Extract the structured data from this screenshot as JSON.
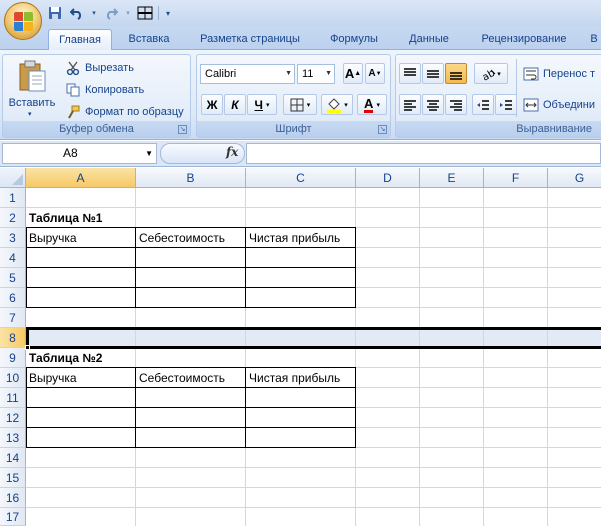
{
  "quick_access": {
    "save_icon": "save-icon",
    "undo_icon": "undo-icon",
    "redo_icon": "redo-icon",
    "customize_icon": "customize-qat-icon"
  },
  "tabs": [
    {
      "label": "Главная",
      "active": true
    },
    {
      "label": "Вставка"
    },
    {
      "label": "Разметка страницы"
    },
    {
      "label": "Формулы"
    },
    {
      "label": "Данные"
    },
    {
      "label": "Рецензирование"
    },
    {
      "label": "В"
    }
  ],
  "ribbon": {
    "clipboard": {
      "label": "Буфер обмена",
      "paste": "Вставить",
      "cut": "Вырезать",
      "copy": "Копировать",
      "format_painter": "Формат по образцу"
    },
    "font": {
      "label": "Шрифт",
      "font_name": "Calibri",
      "font_size": "11",
      "bold": "Ж",
      "italic": "К",
      "underline": "Ч",
      "grow": "A",
      "shrink": "A",
      "font_color_letter": "A"
    },
    "alignment": {
      "label": "Выравнивание",
      "wrap_text": "Перенос т",
      "merge": "Объедини"
    }
  },
  "formula_bar": {
    "name_box": "A8",
    "fx": "fx",
    "value": ""
  },
  "sheet": {
    "columns": [
      "A",
      "B",
      "C",
      "D",
      "E",
      "F",
      "G"
    ],
    "rows": [
      "1",
      "2",
      "3",
      "4",
      "5",
      "6",
      "7",
      "8",
      "9",
      "10",
      "11",
      "12",
      "13",
      "14",
      "15",
      "16",
      "17"
    ],
    "selected_row": "8",
    "selected_cell": "A8",
    "table1": {
      "title": "Таблица №1",
      "headers": [
        "Выручка",
        "Себестоимость",
        "Чистая прибыль"
      ]
    },
    "table2": {
      "title": "Таблица №2",
      "headers": [
        "Выручка",
        "Себестоимость",
        "Чистая прибыль"
      ]
    }
  },
  "colors": {
    "ribbon_text": "#15428b",
    "selection_header": "#f7c966",
    "selected_row_fill": "#e4eaf5"
  }
}
